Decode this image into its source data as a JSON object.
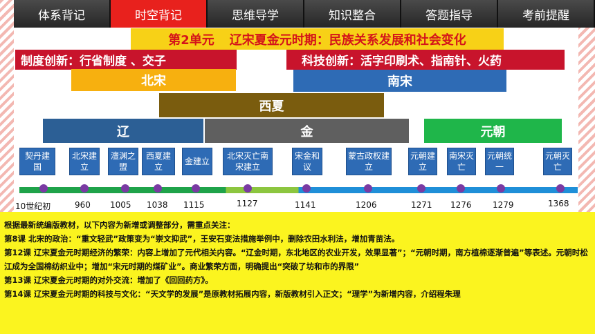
{
  "tabs": [
    {
      "label": "体系背记"
    },
    {
      "label": "时空背记"
    },
    {
      "label": "思维导学"
    },
    {
      "label": "知识整合"
    },
    {
      "label": "答题指导"
    },
    {
      "label": "考前提醒"
    }
  ],
  "unit": {
    "title_left": "第2单元",
    "title_right": "辽宋夏金元时期：民族关系发展和社会变化"
  },
  "banners": {
    "left": "制度创新：行省制度 、交子",
    "right": "科技创新：活字印刷术、指南针、火药"
  },
  "dynasties": {
    "bei_song": "北宋",
    "nan_song": "南宋",
    "xi_xia": "西夏",
    "liao": "辽",
    "jin": "金",
    "yuan": "元朝"
  },
  "events": [
    "契丹建国",
    "北宋建立",
    "澶渊之盟",
    "西夏建立",
    "金建立",
    "北宋灭亡南宋建立",
    "宋金和议",
    "蒙古政权建立",
    "元朝建立",
    "南宋灭亡",
    "元朝统一",
    "元朝灭亡"
  ],
  "years": [
    "10世纪初",
    "960",
    "1005",
    "1038",
    "1115",
    "1127",
    "1141",
    "1206",
    "1271",
    "1276",
    "1279",
    "1368"
  ],
  "notes": {
    "intro": "根据最新统编版教材，以下内容为新增或调整部分，需重点关注：",
    "lesson8": "第8课 北宋的政治：“重文轻武”政策变为“崇文抑武”，王安石变法措施举例中，删除农田水利法，增加青苗法。",
    "lesson12": "第12课 辽宋夏金元时期经济的繁荣：内容上增加了元代相关内容。“辽金时期，东北地区的农业开发，效果显著”；“元朝时期，南方植棉逐渐普遍”等表述。元朝时松江成为全国棉纺织业中；增加“宋元时期的煤矿业”。商业繁荣方面，明确提出“突破了坊和市的界限”",
    "lesson13": "第13课 辽宋夏金元时期的对外交流：增加了《回回药方》。",
    "lesson14": "第14课 辽宋夏金元时期的科技与文化：“天文学的发展”是原教材拓展内容，新版教材引入正文；“理学”为新增内容，介绍程朱理"
  },
  "colors": {
    "tab_active": "#e8211d",
    "unit_bg": "#f7d117",
    "banner_red": "#c8142c",
    "bei_song": "#f7b00f",
    "nan_song": "#2e6bb5",
    "xi_xia": "#7a5c0e",
    "liao": "#2c5f95",
    "jin": "#5f5f5f",
    "yuan": "#1fb64a",
    "notes_bg": "#fbf41f"
  }
}
